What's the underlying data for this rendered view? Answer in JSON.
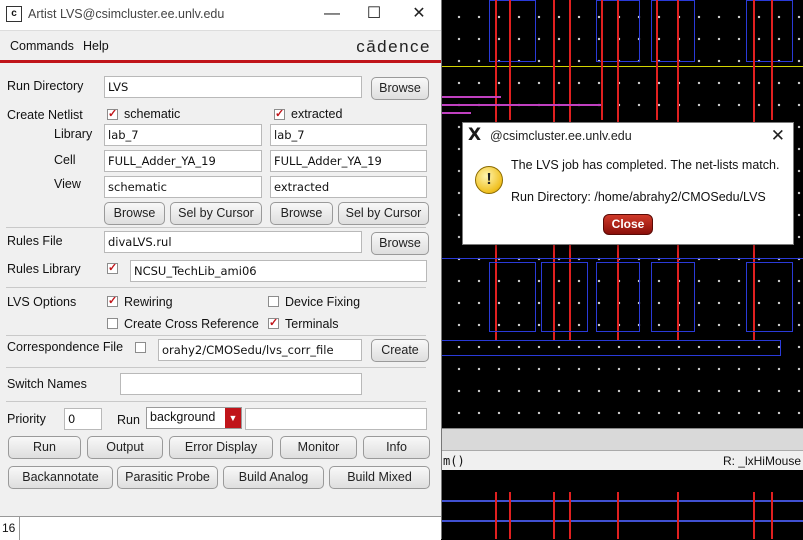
{
  "window": {
    "title": "Artist LVS@csimcluster.ee.unlv.edu",
    "minimize": "—",
    "maximize": "☐",
    "close": "✕"
  },
  "menu": {
    "commands": "Commands",
    "help": "Help",
    "logo": "cādence"
  },
  "run_directory": {
    "label": "Run Directory",
    "value": "LVS",
    "browse": "Browse"
  },
  "netlist": {
    "label": "Create Netlist",
    "schematic_label": "schematic",
    "extracted_label": "extracted",
    "schematic_checked": true,
    "extracted_checked": true,
    "library_label": "Library",
    "cell_label": "Cell",
    "view_label": "View",
    "left": {
      "library": "lab_7",
      "cell": "FULL_Adder_YA_19",
      "view": "schematic"
    },
    "right": {
      "library": "lab_7",
      "cell": "FULL_Adder_YA_19",
      "view": "extracted"
    },
    "browse": "Browse",
    "sel_by_cursor": "Sel by Cursor"
  },
  "rules_file": {
    "label": "Rules File",
    "value": "divaLVS.rul",
    "browse": "Browse"
  },
  "rules_library": {
    "label": "Rules Library",
    "value": "NCSU_TechLib_ami06",
    "checked": true
  },
  "lvs_options": {
    "label": "LVS Options",
    "rewiring": "Rewiring",
    "device_fixing": "Device Fixing",
    "cross_reference": "Create Cross Reference",
    "terminals": "Terminals"
  },
  "correspondence": {
    "label": "Correspondence File",
    "value": "orahy2/CMOSedu/lvs_corr_file",
    "create": "Create"
  },
  "switch_names": {
    "label": "Switch Names",
    "value": ""
  },
  "priority": {
    "label": "Priority",
    "value": "0"
  },
  "run": {
    "label": "Run",
    "mode": "background",
    "extra": ""
  },
  "buttons": {
    "run": "Run",
    "output": "Output",
    "error_display": "Error Display",
    "monitor": "Monitor",
    "info": "Info",
    "backannotate": "Backannotate",
    "parasitic_probe": "Parasitic Probe",
    "build_analog": "Build Analog",
    "build_mixed": "Build Mixed"
  },
  "status": {
    "number": "16"
  },
  "ciw": {
    "left": "m()",
    "right": "R: _lxHiMouse"
  },
  "dialog": {
    "title": "@csimcluster.ee.unlv.edu",
    "message": "The LVS job has completed. The net-lists match.",
    "run_dir": "Run Directory: /home/abrahy2/CMOSedu/LVS",
    "close": "Close"
  },
  "colors": {
    "accent": "#c0141a",
    "dialog_button": "#b0201a"
  }
}
